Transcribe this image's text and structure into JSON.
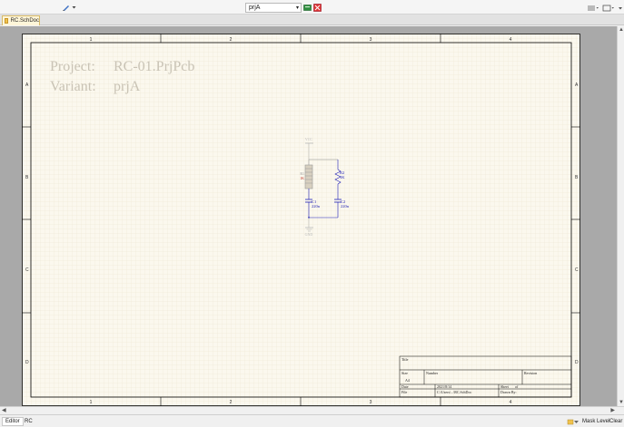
{
  "toolbar": {
    "variant_value": "prjA",
    "icons": [
      "pen-icon",
      "dropdown-icon",
      "variant-manager-icon",
      "close-variant-icon",
      "menu-icon",
      "layout-icon"
    ]
  },
  "document_tabs": [
    {
      "label": "RC.SchDoc",
      "active": true
    }
  ],
  "sheet": {
    "project_line": [
      "Project:",
      "RC-01.PrjPcb"
    ],
    "variant_line": [
      "Variant:",
      "prjA"
    ],
    "zones_top": [
      "1",
      "2",
      "3",
      "4"
    ],
    "zones_side": [
      "A",
      "B",
      "C",
      "D"
    ],
    "title_block": {
      "title_label": "Title",
      "size_label": "Size",
      "size_value": "A4",
      "number_label": "Number",
      "revision_label": "Revision",
      "date_label": "Date",
      "date_value": "2021/8/14",
      "sheet_label": "Sheet",
      "of_label": "of",
      "file_label": "File",
      "file_value": "C:\\Users\\...\\RC.SchDoc",
      "drawn_label": "Drawn By:"
    },
    "schematic": {
      "power_top": "VCC",
      "power_bottom": "GND",
      "r1_ref": "R1",
      "r1_value": "1K",
      "r2_ref": "R2",
      "r2_value": "1K",
      "c1_ref": "C1",
      "c1_value": "220n",
      "c2_ref": "C2",
      "c2_value": "220n"
    },
    "colors": {
      "sheet": "#fbf8ee",
      "grid": "#ece3cf",
      "border": "#000000",
      "component": "#1d1db5",
      "faded": "#b9b9b9",
      "highlight": "#c0392b"
    }
  },
  "statusbar": {
    "tabs": [
      {
        "label": "Editor",
        "active": true
      },
      {
        "label": "RC",
        "active": false
      }
    ],
    "mask_level": "Mask Level",
    "clear": "Clear"
  }
}
